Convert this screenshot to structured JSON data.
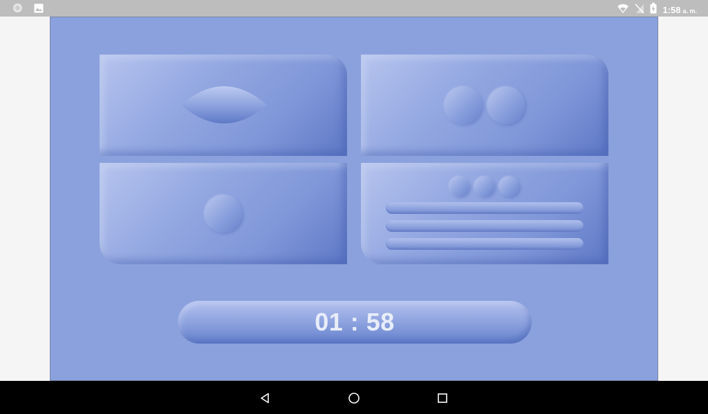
{
  "status_bar": {
    "time": "1:58",
    "ampm": "a. m.",
    "icons": [
      "app-notification-icon",
      "image-notification-icon",
      "wifi-icon",
      "no-signal-icon",
      "battery-charging-icon"
    ]
  },
  "panels": [
    {
      "name": "eye-panel",
      "icon": "eye-shape"
    },
    {
      "name": "two-circles-panel",
      "icon": "two-circles"
    },
    {
      "name": "one-circle-panel",
      "icon": "circle"
    },
    {
      "name": "list-panel",
      "icon": "three-dots-and-bars"
    }
  ],
  "timer": {
    "text": "01 : 58"
  },
  "nav_bar": {
    "icons": [
      "back-icon",
      "home-icon",
      "recents-icon"
    ]
  },
  "colors": {
    "screen_bg": "#8aa1dd",
    "status_bar": "#bdbdbd",
    "nav_bar": "#000000",
    "timer_text": "#e8edf9"
  }
}
